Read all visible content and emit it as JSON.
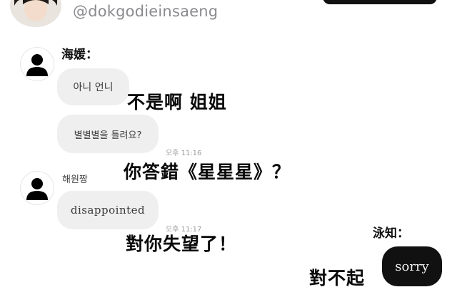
{
  "header": {
    "handle": "@dokgodieinsaeng"
  },
  "messages": [
    {
      "sender": "海媛：",
      "bubbles": [
        "아니 언니",
        "별별별을 틀려요?"
      ],
      "translation": [
        "不是啊 姐姐",
        "你答錯《星星星》？"
      ],
      "time": "오후 11:16"
    },
    {
      "sender": "해원짱",
      "bubbles": [
        "disappointed"
      ],
      "translation": [
        "對你失望了！"
      ],
      "time": "오후 11:17"
    },
    {
      "sender": "泳知：",
      "bubbles": [
        "sorry"
      ],
      "translation": [
        "對不起"
      ]
    }
  ]
}
